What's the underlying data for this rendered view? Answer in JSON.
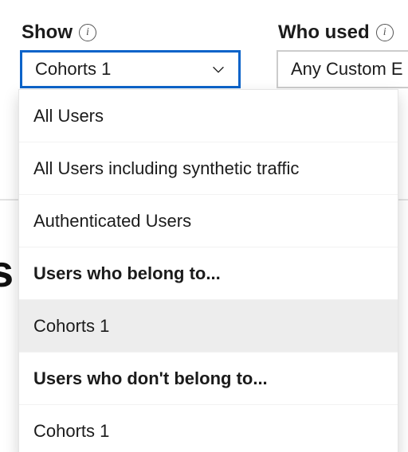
{
  "fields": {
    "show": {
      "label": "Show",
      "selected": "Cohorts 1"
    },
    "who_used": {
      "label": "Who used",
      "selected": "Any Custom E"
    }
  },
  "dropdown": {
    "items": [
      {
        "label": "All Users",
        "kind": "normal",
        "selected": false
      },
      {
        "label": "All Users including synthetic traffic",
        "kind": "normal",
        "selected": false
      },
      {
        "label": "Authenticated Users",
        "kind": "normal",
        "selected": false
      },
      {
        "label": "Users who belong to...",
        "kind": "group-header",
        "selected": false
      },
      {
        "label": "Cohorts 1",
        "kind": "normal",
        "selected": true
      },
      {
        "label": "Users who don't belong to...",
        "kind": "group-header",
        "selected": false
      },
      {
        "label": "Cohorts 1",
        "kind": "normal",
        "selected": false
      }
    ]
  },
  "bg_fragment": "s"
}
